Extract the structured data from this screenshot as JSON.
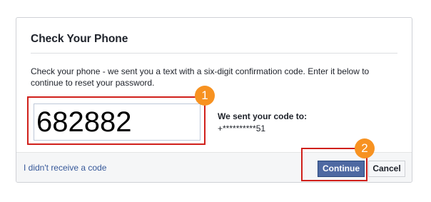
{
  "dialog": {
    "title": "Check Your Phone",
    "description": "Check your phone - we sent you a text with a six-digit confirmation code. Enter it below to continue to reset your password.",
    "code_input": {
      "value": "682882"
    },
    "sent_label": "We sent your code to:",
    "sent_number": "+**********51",
    "footer": {
      "no_code_link": "I didn't receive a code",
      "continue_label": "Continue",
      "cancel_label": "Cancel"
    }
  },
  "annotations": {
    "badge_1": "1",
    "badge_2": "2"
  },
  "colors": {
    "highlight_border": "#d0201b",
    "badge": "#f79221",
    "primary_button": "#4e69a2",
    "link": "#365899"
  }
}
